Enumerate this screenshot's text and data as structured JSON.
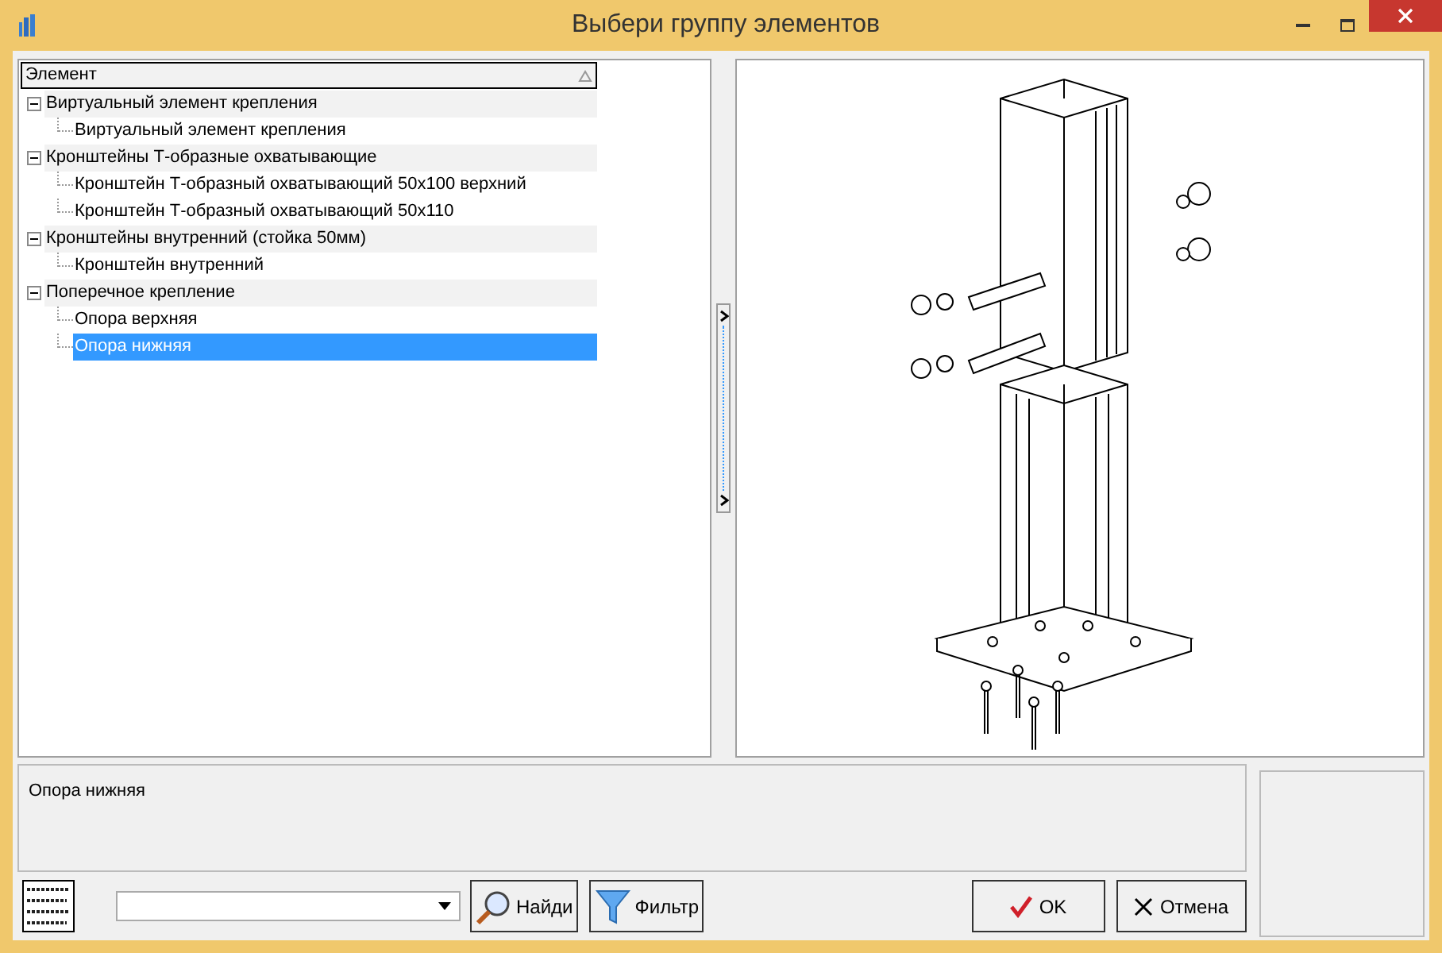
{
  "window": {
    "title": "Выбери группу элементов"
  },
  "tree": {
    "column": "Элемент",
    "items": [
      {
        "label": "Виртуальный элемент крепления",
        "expanded": true,
        "selected": false,
        "children": [
          {
            "label": "Виртуальный элемент крепления",
            "selected": false
          }
        ]
      },
      {
        "label": "Кронштейны Т-образные охватывающие",
        "expanded": true,
        "selected": false,
        "children": [
          {
            "label": "Кронштейн Т-образный охватывающий 50х100 верхний",
            "selected": false
          },
          {
            "label": "Кронштейн Т-образный охватывающий 50х110",
            "selected": false
          }
        ]
      },
      {
        "label": "Кронштейны внутренний (стойка 50мм)",
        "expanded": true,
        "selected": false,
        "children": [
          {
            "label": "Кронштейн внутренний",
            "selected": false
          }
        ]
      },
      {
        "label": "Поперечное крепление",
        "expanded": true,
        "selected": false,
        "children": [
          {
            "label": "Опора верхняя",
            "selected": false
          },
          {
            "label": "Опора нижняя",
            "selected": true
          }
        ]
      }
    ]
  },
  "description": "Опора нижняя",
  "buttons": {
    "find": "Найди",
    "filter": "Фильтр",
    "ok": "OK",
    "cancel": "Отмена"
  }
}
